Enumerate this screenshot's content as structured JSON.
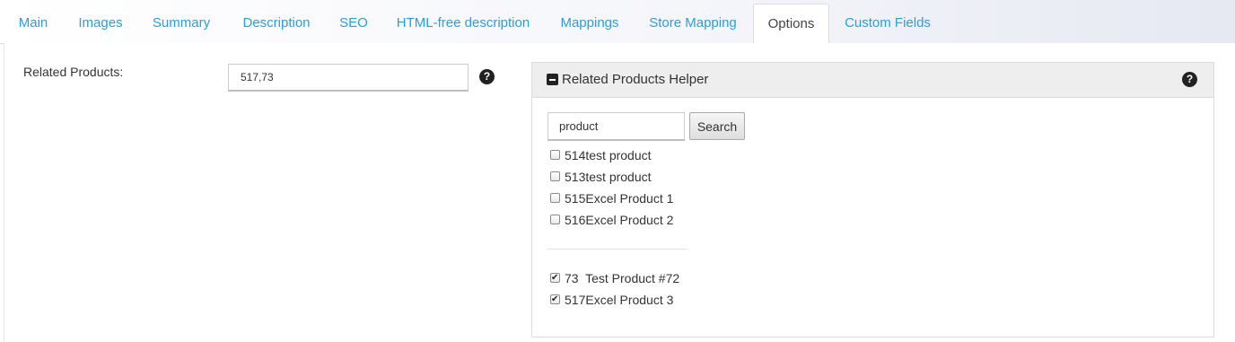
{
  "tabs": [
    {
      "label": "Main"
    },
    {
      "label": "Images"
    },
    {
      "label": "Summary"
    },
    {
      "label": "Description"
    },
    {
      "label": "SEO"
    },
    {
      "label": "HTML-free description"
    },
    {
      "label": "Mappings"
    },
    {
      "label": "Store Mapping"
    },
    {
      "label": "Options",
      "active": true
    },
    {
      "label": "Custom Fields"
    }
  ],
  "related_products": {
    "label": "Related Products:",
    "value": "517,73",
    "help_icon": "question-circle-icon"
  },
  "helper": {
    "title": "Related Products Helper",
    "collapse_icon": "minus-square-icon",
    "help_icon": "question-circle-icon",
    "search_value": "product",
    "search_button": "Search",
    "results": [
      {
        "label": "514test product",
        "checked": false
      },
      {
        "label": "513test product",
        "checked": false
      },
      {
        "label": "515Excel Product 1",
        "checked": false
      },
      {
        "label": "516Excel Product 2",
        "checked": false
      }
    ],
    "selected": [
      {
        "label": "73  Test Product #72",
        "checked": true
      },
      {
        "label": "517Excel Product 3",
        "checked": true
      }
    ]
  },
  "colors": {
    "tab_link": "#2a9fd6",
    "tab_active_text": "#444444",
    "panel_header": "#eeeeee"
  }
}
